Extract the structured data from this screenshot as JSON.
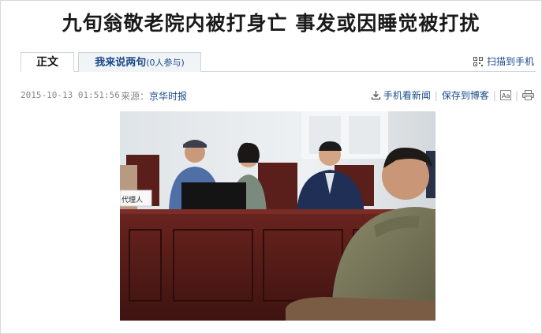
{
  "article": {
    "headline": "九旬翁敬老院内被打身亡 事发或因睡觉被打扰",
    "tab_main": "正文",
    "tab_comment": "我来说两句",
    "tab_comment_count": "(0人参与)",
    "scan_to_phone": "扫描到手机",
    "date": "2015-10-13 01:51:56",
    "source_label": "来源：",
    "source_name": "京华时报",
    "tools": {
      "mobile_news": "手机看新闻",
      "save_to_blog": "保存到博客"
    },
    "photo": {
      "desk_sign": "代理人",
      "description_icon": "courtroom-photo"
    }
  },
  "colors": {
    "link": "#1a4a8a",
    "meta_gray": "#888888",
    "border": "#cfd6df",
    "tab_bg": "#f1f4f7"
  },
  "icons": [
    "qr-code-icon",
    "download-icon",
    "font-size-icon",
    "print-icon"
  ]
}
